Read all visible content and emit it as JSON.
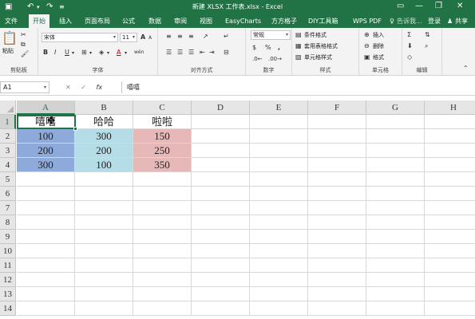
{
  "app": {
    "window_title": "新建 XLSX 工作表.xlsx - Excel",
    "quick_access": {
      "save_icon": "save-icon",
      "undo_icon": "undo-icon",
      "redo_icon": "redo-icon"
    },
    "window_controls": {
      "help": "?",
      "minimize": "—",
      "restore": "❐",
      "close": "✕"
    }
  },
  "ribbon_tabs": [
    "文件",
    "开始",
    "插入",
    "页面布局",
    "公式",
    "数据",
    "审阅",
    "视图",
    "EasyCharts",
    "方方格子",
    "DIY工具箱",
    "WPS PDF"
  ],
  "active_tab": "开始",
  "tab_controls": {
    "tell_me": "告诉我...",
    "login": "登录",
    "share": "共享"
  },
  "ribbon": {
    "clipboard": {
      "label": "剪贴板",
      "paste": "粘贴"
    },
    "font": {
      "label": "字体",
      "font_name": "宋体",
      "font_size": "11",
      "bold": "B",
      "italic": "I",
      "underline": "U",
      "grow": "A",
      "shrink": "A",
      "font_color_glyph": "A",
      "phonetic": "wén"
    },
    "alignment": {
      "label": "对齐方式"
    },
    "number": {
      "label": "数字",
      "format": "常规",
      "currency": "$",
      "percent": "%",
      "comma": ","
    },
    "styles": {
      "label": "样式",
      "items": [
        "条件格式",
        "套用表格格式",
        "单元格样式"
      ]
    },
    "cells": {
      "label": "单元格",
      "items": [
        "插入",
        "删除",
        "格式"
      ]
    },
    "editing": {
      "label": "编辑"
    }
  },
  "formula_bar": {
    "name_box": "A1",
    "cancel": "✕",
    "enter": "✓",
    "fx": "fx",
    "content": "嘻嘻"
  },
  "sheet": {
    "columns": [
      "A",
      "B",
      "C",
      "D",
      "E",
      "F",
      "G",
      "H"
    ],
    "rows": [
      "1",
      "2",
      "3",
      "4",
      "5",
      "6",
      "7",
      "8",
      "9",
      "10",
      "11",
      "12",
      "13",
      "14"
    ],
    "selected_cell": "A1",
    "header_row": [
      "嘻嘻",
      "哈哈",
      "啦啦"
    ],
    "data_rows": [
      [
        "100",
        "300",
        "150"
      ],
      [
        "200",
        "200",
        "250"
      ],
      [
        "300",
        "100",
        "350"
      ]
    ],
    "column_fills": [
      "#8eaadb",
      "#b4dde8",
      "#e6b8b7"
    ]
  }
}
